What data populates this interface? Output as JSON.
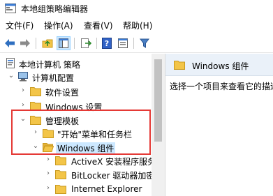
{
  "window": {
    "title": "本地组策略编辑器",
    "icon": "group-policy-icon"
  },
  "menu": [
    "文件(F)",
    "操作(A)",
    "查看(V)",
    "帮助(H)"
  ],
  "toolbar": {
    "buttons": [
      "back-arrow-icon",
      "forward-arrow-icon",
      "up-folder-icon",
      "show-hide-tree-icon",
      "export-list-icon",
      "help-icon",
      "properties-icon",
      "filter-icon"
    ],
    "selected": "show-hide-tree-icon"
  },
  "tree": {
    "root": "本地计算机 策略",
    "computer_config": "计算机配置",
    "software_settings": "软件设置",
    "windows_settings": "Windows 设置",
    "admin_templates": "管理模板",
    "start_menu": "\"开始\"菜单和任务栏",
    "windows_components": "Windows 组件",
    "activex": "ActiveX 安装程序服务",
    "bitlocker": "BitLocker 驱动器加密",
    "ie": "Internet Explorer"
  },
  "right_pane": {
    "header": "Windows 组件",
    "description": "选择一个项目来查看它的描述。"
  },
  "colors": {
    "selection": "#cce8ff",
    "highlight_border": "#e53935",
    "folder": "#f3c548"
  }
}
